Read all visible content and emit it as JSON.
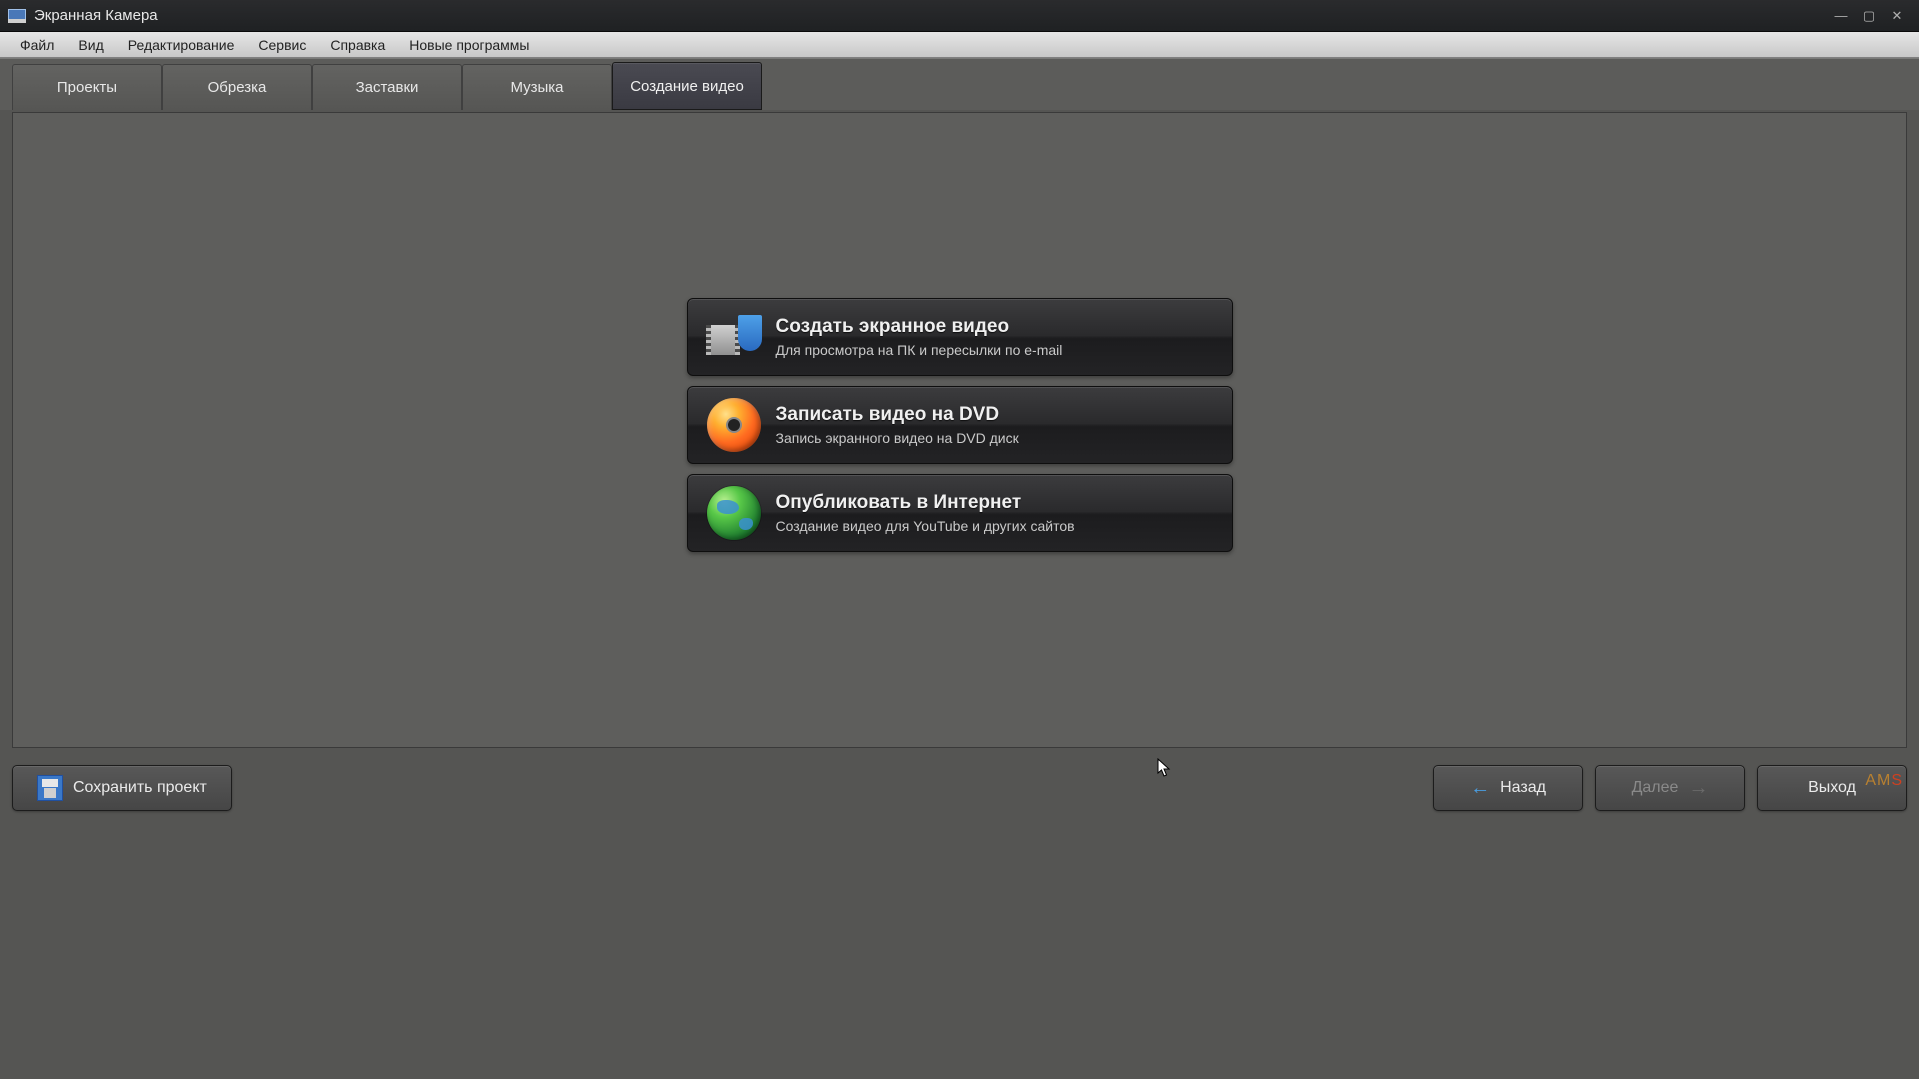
{
  "titlebar": {
    "title": "Экранная Камера"
  },
  "menubar": {
    "items": [
      "Файл",
      "Вид",
      "Редактирование",
      "Сервис",
      "Справка",
      "Новые программы"
    ]
  },
  "tabs": {
    "items": [
      {
        "label": "Проекты"
      },
      {
        "label": "Обрезка"
      },
      {
        "label": "Заставки"
      },
      {
        "label": "Музыка"
      },
      {
        "label": "Создание видео"
      }
    ],
    "active_index": 4
  },
  "actions": [
    {
      "title": "Создать экранное видео",
      "subtitle": "Для просмотра на ПК и пересылки по e-mail"
    },
    {
      "title": "Записать видео на DVD",
      "subtitle": "Запись экранного видео на DVD диск"
    },
    {
      "title": "Опубликовать в Интернет",
      "subtitle": "Создание видео для YouTube и других сайтов"
    }
  ],
  "footer": {
    "save_label": "Сохранить проект",
    "back_label": "Назад",
    "next_label": "Далее",
    "exit_label": "Выход"
  },
  "brand": {
    "prefix": "AM",
    "suffix": "S"
  }
}
